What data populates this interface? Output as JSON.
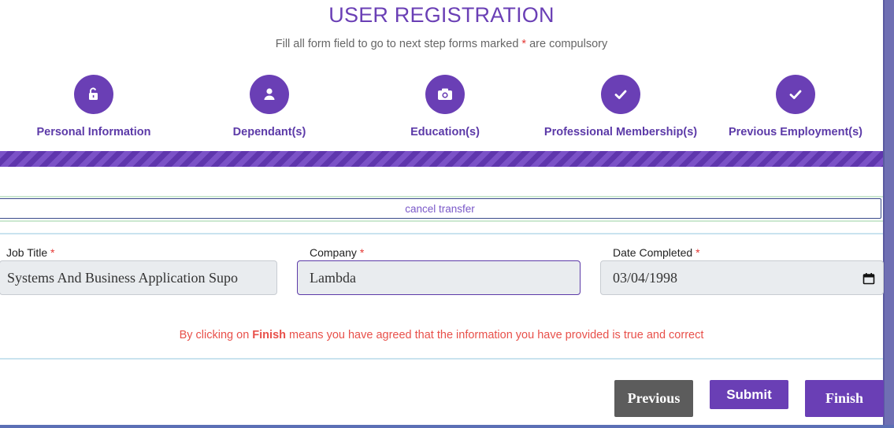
{
  "header": {
    "title": "USER REGISTRATION",
    "subtitle_before": "Fill all form field to go to next step forms marked ",
    "required_mark": "*",
    "subtitle_after": " are compulsory"
  },
  "steps": [
    {
      "label": "Personal Information",
      "icon": "unlock-icon"
    },
    {
      "label": "Dependant(s)",
      "icon": "user-icon"
    },
    {
      "label": "Education(s)",
      "icon": "camera-icon"
    },
    {
      "label": "Professional Membership(s)",
      "icon": "check-icon"
    },
    {
      "label": "Previous Employment(s)",
      "icon": "check-icon"
    }
  ],
  "cancel_transfer": "cancel transfer",
  "form": {
    "job_title": {
      "label": "Job Title ",
      "required": "*",
      "value": "Systems And Business Application Supo"
    },
    "company": {
      "label": "Company ",
      "required": "*",
      "value": "Lambda"
    },
    "date_completed": {
      "label": "Date Completed ",
      "required": "*",
      "value": "03/04/1998"
    }
  },
  "agreement": {
    "before": "By clicking on ",
    "bold": "Finish",
    "after": " means you have agreed that the information you have provided is true and correct"
  },
  "buttons": {
    "previous": "Previous",
    "submit": "Submit",
    "finish": "Finish"
  },
  "colors": {
    "accent": "#6a3fb5",
    "required": "#e53935",
    "agreement_text": "#e8504a",
    "previous_button": "#5c5c5c"
  }
}
